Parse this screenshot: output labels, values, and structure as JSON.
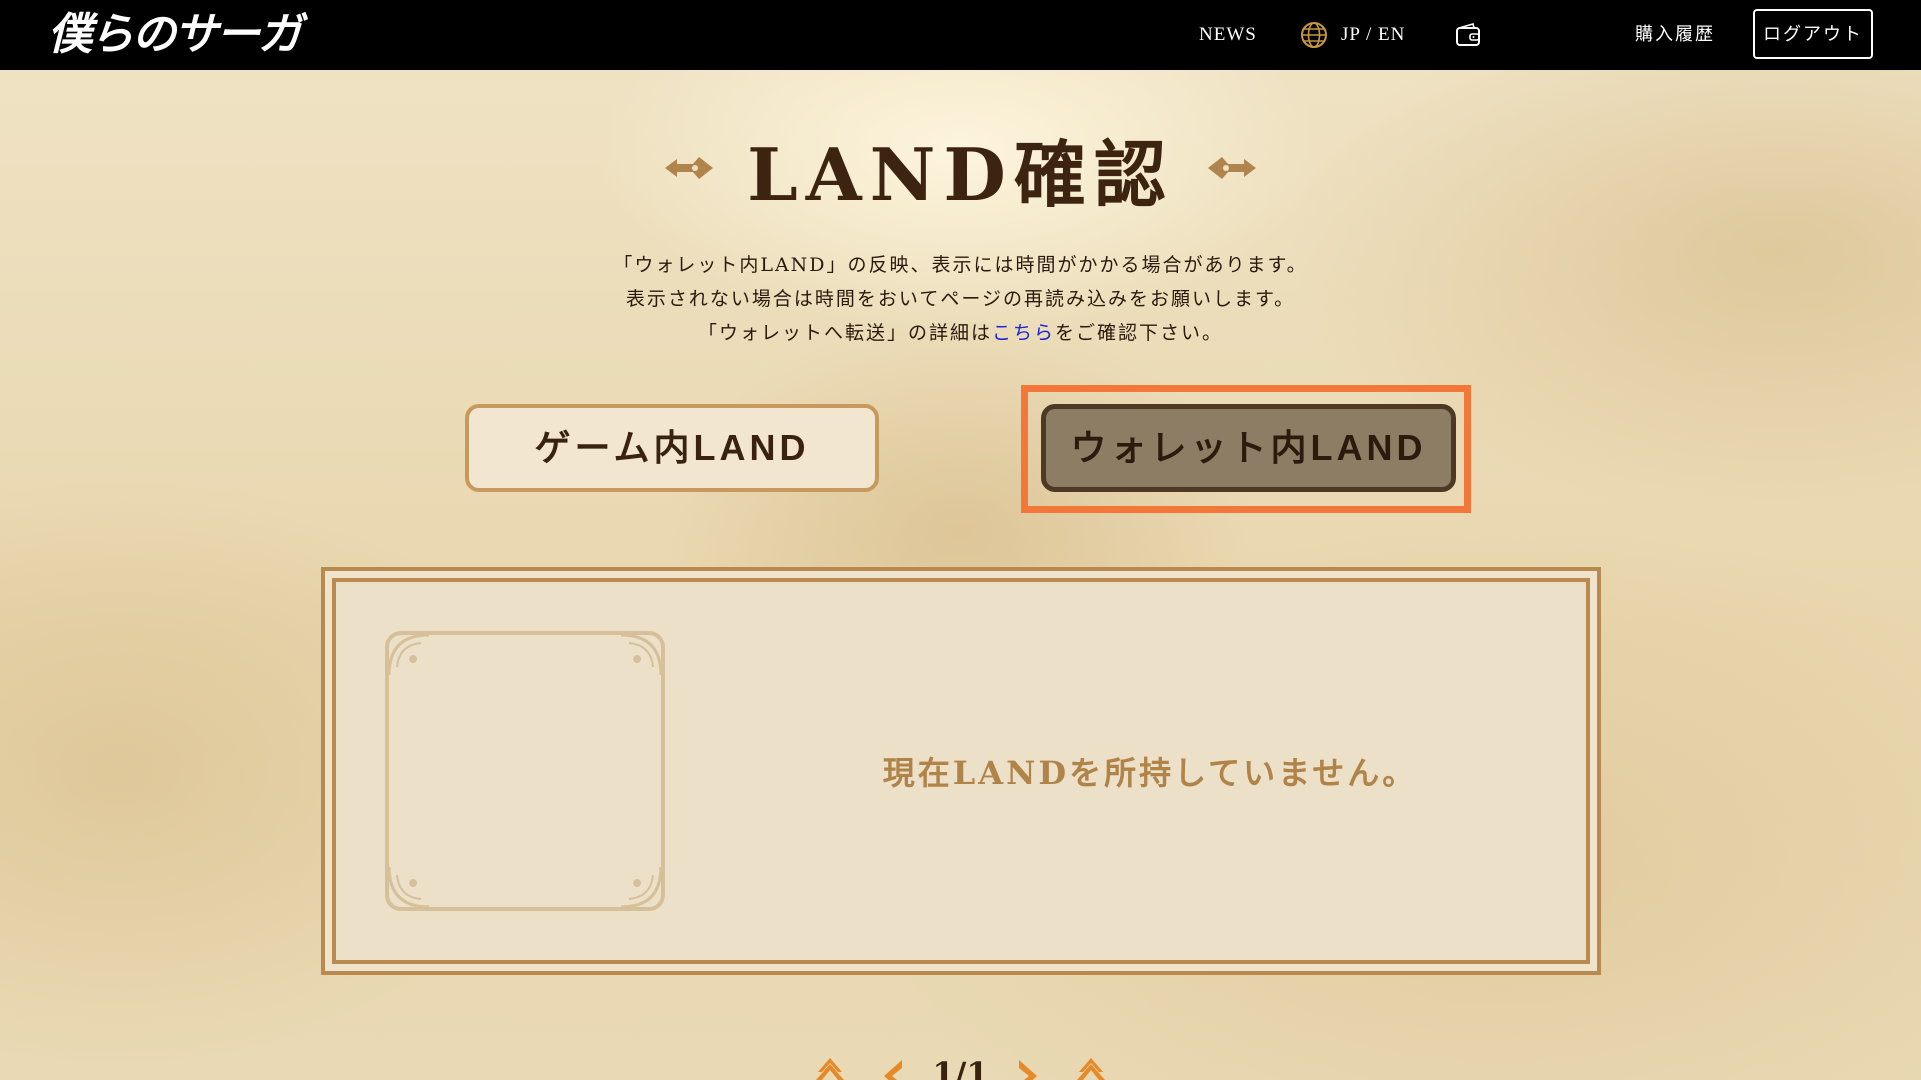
{
  "header": {
    "logo_text": "僕らのサーガ",
    "news_label": "NEWS",
    "lang_label": "JP / EN",
    "history_label": "購入履歴",
    "logout_label": "ログアウト"
  },
  "page": {
    "title": "LAND確認",
    "desc_line1": "「ウォレット内LAND」の反映、表示には時間がかかる場合があります。",
    "desc_line2": "表示されない場合は時間をおいてページの再読み込みをお願いします。",
    "desc_line3_pre": "「ウォレットへ転送」の詳細は",
    "desc_line3_link": "こちら",
    "desc_line3_post": "をご確認下さい。"
  },
  "tabs": {
    "game_land": "ゲーム内LAND",
    "wallet_land": "ウォレット内LAND"
  },
  "land": {
    "empty_message": "現在LANDを所持していません。"
  },
  "pager": {
    "label": "1/1"
  },
  "colors": {
    "accent_highlight": "#f4773a",
    "frame_gold": "#b88a50",
    "link_blue": "#1d24d8",
    "pager_orange": "#e58a2a"
  }
}
